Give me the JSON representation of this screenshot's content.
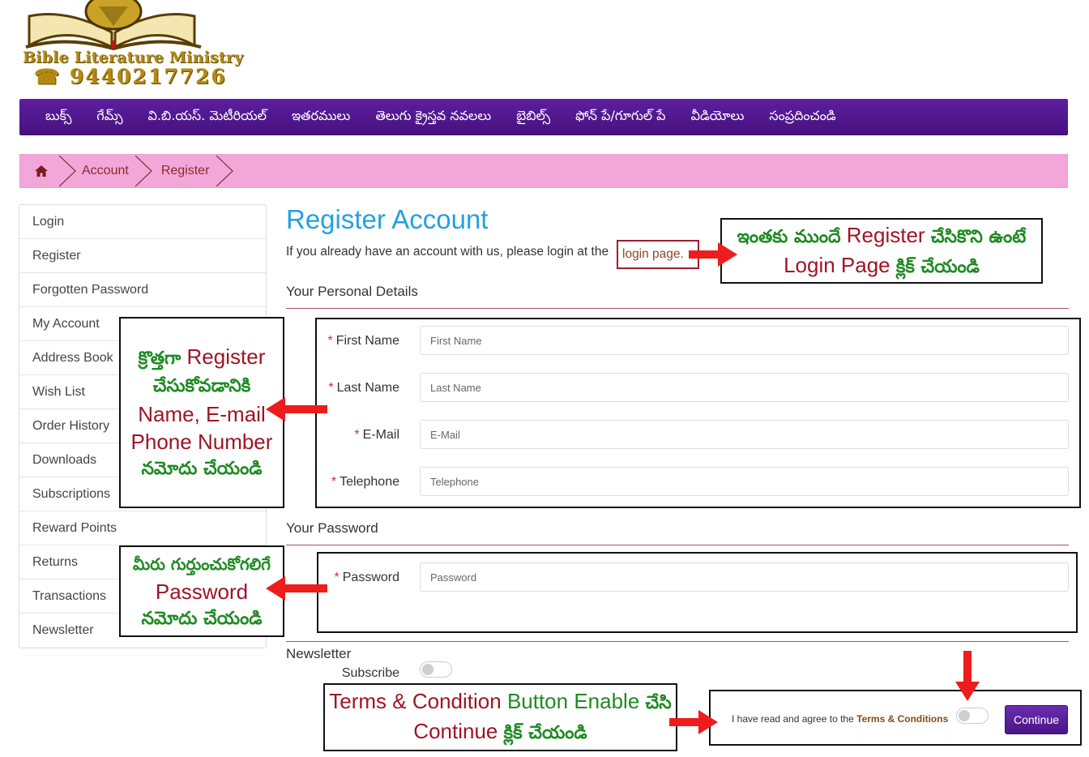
{
  "logo": {
    "name": "Bible Literature Ministry",
    "phone": "☎ 9440217726"
  },
  "nav": {
    "items": [
      "బుక్స్",
      "గేమ్స్",
      "వి.బి.యస్. మెటీరియల్",
      "ఇతరములు",
      "తెలుగు క్రైస్తవ నవలలు",
      "బైబిల్స్",
      "ఫోన్ పే/గూగుల్ పే",
      "వీడియోలు",
      "సంప్రదించండి"
    ]
  },
  "breadcrumb": {
    "items": [
      "Account",
      "Register"
    ]
  },
  "sidebar": {
    "items": [
      "Login",
      "Register",
      "Forgotten Password",
      "My Account",
      "Address Book",
      "Wish List",
      "Order History",
      "Downloads",
      "Subscriptions",
      "Reward Points",
      "Returns",
      "Transactions",
      "Newsletter"
    ]
  },
  "main": {
    "title": "Register Account",
    "intro": "If you already have an account with us, please login at the",
    "login_link": "login page",
    "intro_end": ".",
    "personal_legend": "Your Personal Details",
    "password_legend": "Your Password",
    "newsletter_legend": "Newsletter",
    "subscribe_label": "Subscribe",
    "fields": [
      {
        "label": "First Name",
        "placeholder": "First Name"
      },
      {
        "label": "Last Name",
        "placeholder": "Last Name"
      },
      {
        "label": "E-Mail",
        "placeholder": "E-Mail"
      },
      {
        "label": "Telephone",
        "placeholder": "Telephone"
      }
    ],
    "password": {
      "label": "Password",
      "placeholder": "Password"
    },
    "required_mark": "*",
    "agree_text": "I have read and agree to the",
    "agree_link": "Terms & Conditions",
    "continue_label": "Continue",
    "subscribe_on": false,
    "agree_on": false
  },
  "callouts": {
    "login": {
      "line1_te1": "ఇంతకు ముందే",
      "line1_en": "Register",
      "line1_te2": "చేసికొని ఉంటే",
      "line2_en": "Login Page",
      "line2_te": "క్లిక్ చేయండి"
    },
    "register": {
      "line1_te": "క్రొత్తగా",
      "line1_en": "Register",
      "line2_te": "చేసుకోవడానికి",
      "line3_en": "Name, E-mail",
      "line4_en": "Phone Number",
      "line5_te": "నమోదు చేయండి"
    },
    "password": {
      "line1_te": "మీరు గుర్తుంచుకోగలిగే",
      "line2_en": "Password",
      "line3_te": "నమోదు చేయండి"
    },
    "terms": {
      "line1_en": "Terms & Condition",
      "line1_te_en": "Button Enable",
      "line1_te": "చేసి",
      "line2_en": "Continue",
      "line2_te": "క్లిక్ చేయండి"
    }
  },
  "colors": {
    "nav_bg": "#4f1690",
    "breadcrumb_bg": "#f3a7d9",
    "title": "#23a1e0",
    "callout_green": "#1f8a23",
    "callout_red": "#a11424",
    "arrow": "#ee1c1c"
  }
}
